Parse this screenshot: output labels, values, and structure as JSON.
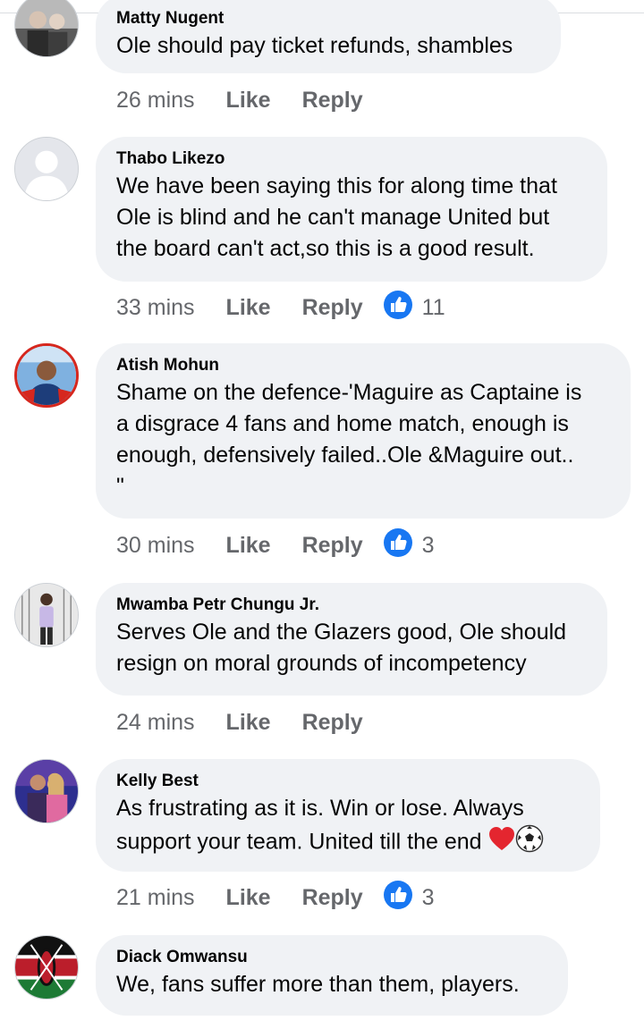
{
  "colors": {
    "bubble": "#f0f2f5",
    "meta": "#65676b",
    "like_badge": "#1877f2",
    "heart": "#e4262f"
  },
  "comments": [
    {
      "name": "Matty Nugent",
      "text": "Ole should pay ticket refunds, shambles",
      "time": "26 mins",
      "like": "Like",
      "reply": "Reply",
      "reactions": ""
    },
    {
      "name": "Thabo Likezo",
      "text": "We have been saying this for along time that\nOle is blind and he can't manage United but\nthe board can't act,so this is a good result.",
      "time": "33 mins",
      "like": "Like",
      "reply": "Reply",
      "reactions": "11"
    },
    {
      "name": "Atish Mohun",
      "text": "Shame on the defence-'Maguire as Captaine is\na disgrace 4 fans and home match, enough is\nenough, defensively failed..Ole &Maguire out..\n\"",
      "time": "30 mins",
      "like": "Like",
      "reply": "Reply",
      "reactions": "3"
    },
    {
      "name": "Mwamba Petr Chungu Jr.",
      "text": "Serves Ole and the Glazers good, Ole should\nresign on moral grounds of incompetency",
      "time": "24 mins",
      "like": "Like",
      "reply": "Reply",
      "reactions": ""
    },
    {
      "name": "Kelly Best",
      "text": "As frustrating as it is. Win or lose. Always\nsupport your team. United till the end",
      "emoji": [
        "heart-emoji",
        "soccer-ball-emoji"
      ],
      "time": "21 mins",
      "like": "Like",
      "reply": "Reply",
      "reactions": "3"
    },
    {
      "name": "Diack Omwansu",
      "text": "We, fans suffer more than them, players.",
      "time": "",
      "like": "",
      "reply": "",
      "reactions": ""
    }
  ]
}
